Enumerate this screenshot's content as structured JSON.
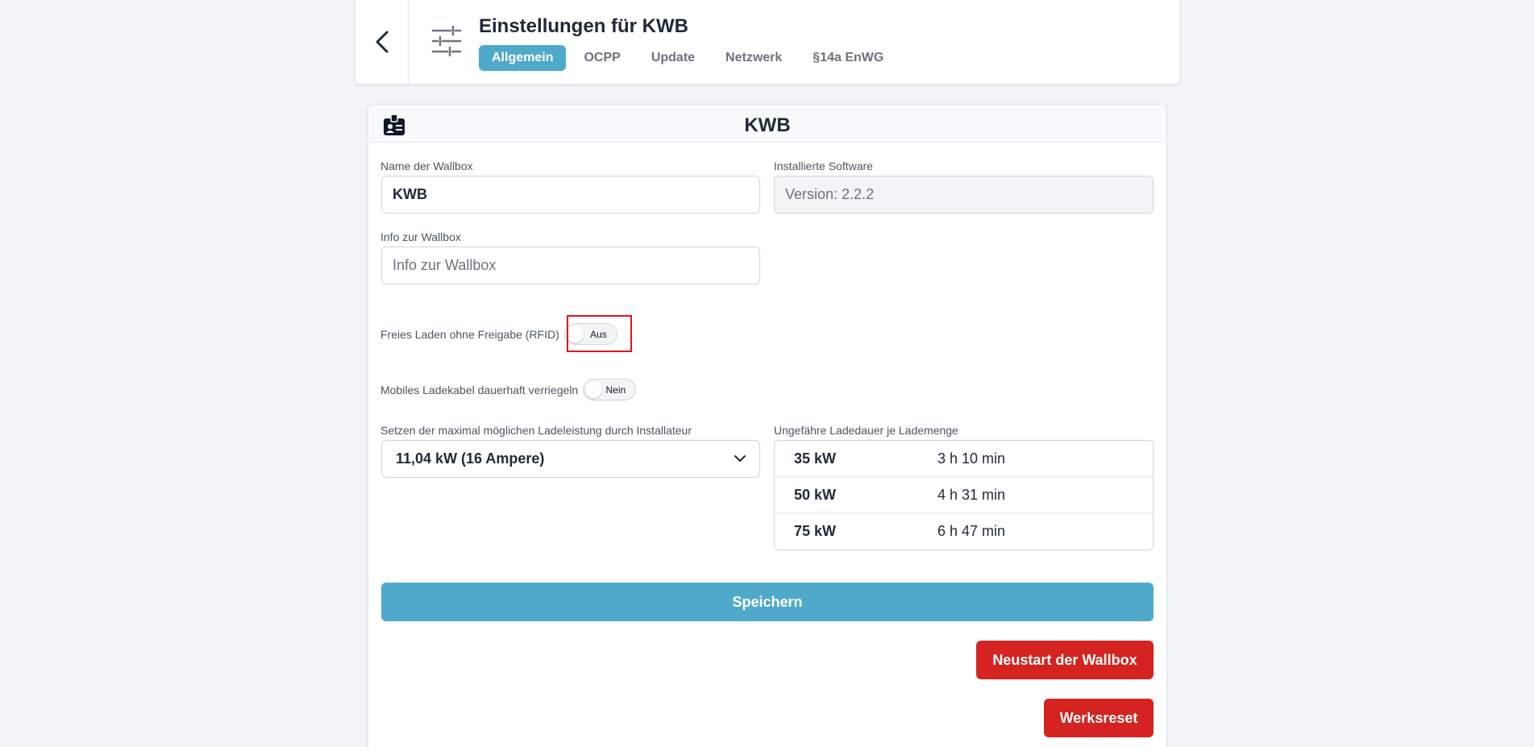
{
  "header": {
    "title": "Einstellungen für KWB",
    "tabs": [
      {
        "label": "Allgemein",
        "active": true
      },
      {
        "label": "OCPP",
        "active": false
      },
      {
        "label": "Update",
        "active": false
      },
      {
        "label": "Netzwerk",
        "active": false
      },
      {
        "label": "§14a EnWG",
        "active": false
      }
    ]
  },
  "card": {
    "title": "KWB",
    "name_field": {
      "label": "Name der Wallbox",
      "value": "KWB"
    },
    "software_field": {
      "label": "Installierte Software",
      "value": "Version: 2.2.2"
    },
    "info_field": {
      "label": "Info zur Wallbox",
      "placeholder": "Info zur Wallbox"
    },
    "free_charging": {
      "label": "Freies Laden ohne Freigabe (RFID)",
      "state": "Aus"
    },
    "cable_lock": {
      "label": "Mobiles Ladekabel dauerhaft verriegeln",
      "state": "Nein"
    },
    "max_power": {
      "label": "Setzen der maximal möglichen Ladeleistung durch Installateur",
      "value": "11,04 kW (16 Ampere)"
    },
    "duration": {
      "label": "Ungefähre Ladedauer je Lademenge",
      "rows": [
        {
          "power": "35 kW",
          "time": "3 h 10 min"
        },
        {
          "power": "50 kW",
          "time": "4 h 31 min"
        },
        {
          "power": "75 kW",
          "time": "6 h 47 min"
        }
      ]
    },
    "save_label": "Speichern",
    "restart_label": "Neustart der Wallbox",
    "reset_label": "Werksreset"
  },
  "colors": {
    "accent": "#4fa9cb",
    "danger": "#d42320",
    "highlight": "#e0151f"
  }
}
